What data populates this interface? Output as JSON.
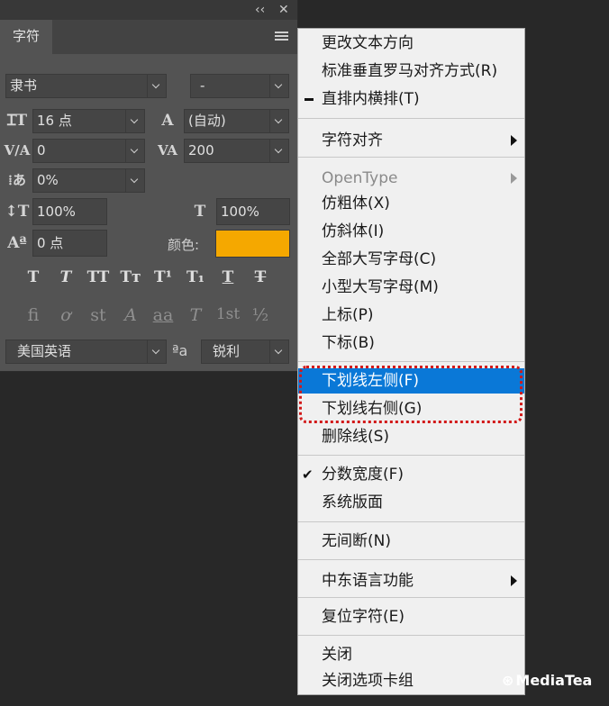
{
  "panel": {
    "controls": {
      "collapse": "‹‹",
      "close": "✕"
    },
    "tab": "字符",
    "font_family": "隶书",
    "font_style": "-",
    "font_size": "16 点",
    "leading": "(自动)",
    "kerning": "0",
    "tracking": "200",
    "tsume": "0%",
    "vertical_scale": "100%",
    "horizontal_scale": "100%",
    "baseline_shift": "0 点",
    "color_label": "颜色:",
    "color_value": "#f5a800",
    "type_buttons": [
      "T",
      "T",
      "TT",
      "Tт",
      "T¹",
      "T₁",
      "T",
      "T"
    ],
    "opentype_buttons": [
      "ﬁ",
      "ơ",
      "st",
      "A",
      "aa",
      "T",
      "1st",
      "½"
    ],
    "language": "美国英语",
    "aa_label": "ªa",
    "antialias": "锐利"
  },
  "menu": {
    "items": [
      {
        "label": "更改文本方向"
      },
      {
        "label": "标准垂直罗马对齐方式(R)"
      },
      {
        "label": "直排内横排(T)"
      },
      {
        "label": "字符对齐"
      },
      {
        "label": "OpenType"
      },
      {
        "label": "仿粗体(X)"
      },
      {
        "label": "仿斜体(I)"
      },
      {
        "label": "全部大写字母(C)"
      },
      {
        "label": "小型大写字母(M)"
      },
      {
        "label": "上标(P)"
      },
      {
        "label": "下标(B)"
      },
      {
        "label": "下划线左侧(F)"
      },
      {
        "label": "下划线右侧(G)"
      },
      {
        "label": "删除线(S)"
      },
      {
        "label": "分数宽度(F)"
      },
      {
        "label": "系统版面"
      },
      {
        "label": "无间断(N)"
      },
      {
        "label": "中东语言功能"
      },
      {
        "label": "复位字符(E)"
      },
      {
        "label": "关闭"
      },
      {
        "label": "关闭选项卡组"
      }
    ],
    "highlight_color": "#0a78d7"
  },
  "watermark": {
    "text": "MediaTea"
  }
}
